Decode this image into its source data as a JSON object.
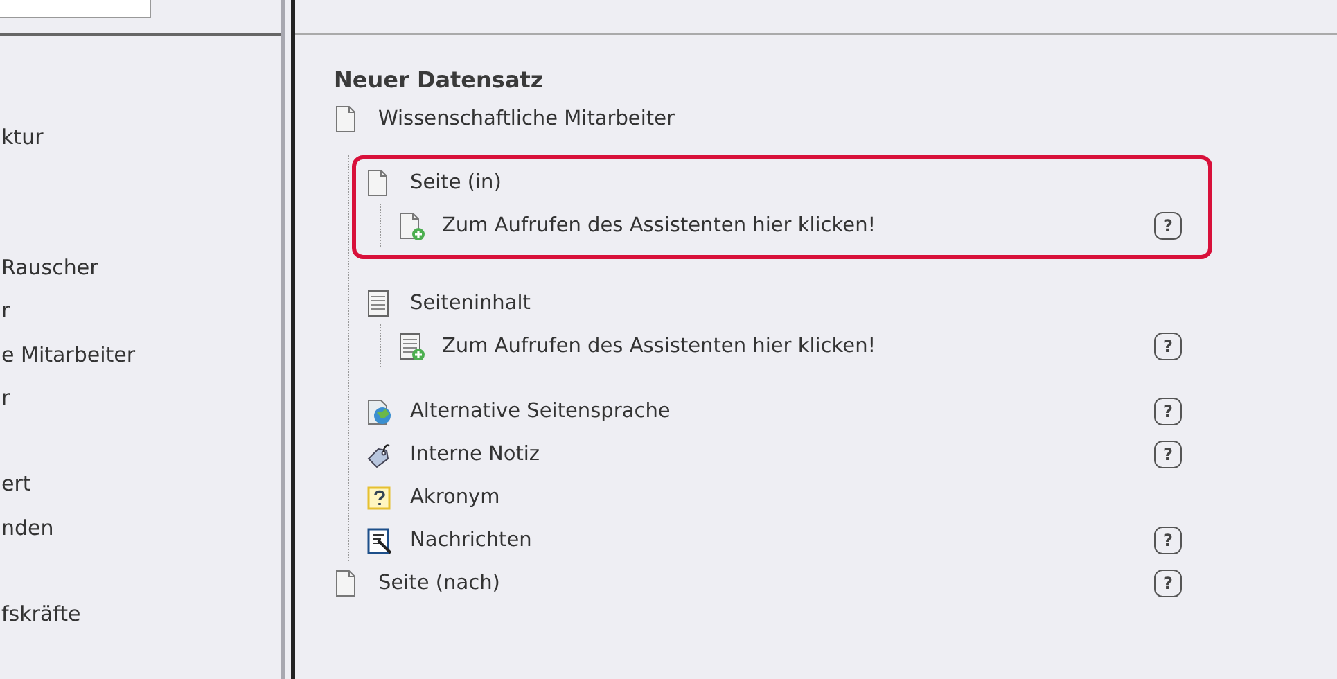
{
  "sidebar": {
    "items": [
      {
        "label": "ktur"
      },
      {
        "label": "Rauscher"
      },
      {
        "label": "r"
      },
      {
        "label": "e Mitarbeiter"
      },
      {
        "label": "r"
      },
      {
        "label": "ert"
      },
      {
        "label": "nden"
      },
      {
        "label": "fskräfte"
      }
    ]
  },
  "panel": {
    "title": "Neuer Datensatz",
    "tree": [
      {
        "kind": "page",
        "label": "Wissenschaftliche Mitarbeiter",
        "children": [
          {
            "kind": "page",
            "label": "Seite (in)",
            "highlighted": true,
            "children": [
              {
                "kind": "page-add",
                "label": "Zum Aufrufen des Assistenten hier klicken!",
                "help": "?"
              }
            ]
          },
          {
            "kind": "content",
            "label": "Seiteninhalt",
            "highlighted": false,
            "children": [
              {
                "kind": "content-add",
                "label": "Zum Aufrufen des Assistenten hier klicken!",
                "help": "?"
              }
            ]
          },
          {
            "kind": "globe",
            "label": "Alternative Seitensprache",
            "help": "?"
          },
          {
            "kind": "tag",
            "label": "Interne Notiz",
            "help": "?"
          },
          {
            "kind": "acronym",
            "label": "Akronym"
          },
          {
            "kind": "notepad",
            "label": "Nachrichten",
            "help": "?"
          }
        ]
      },
      {
        "kind": "page",
        "label": "Seite (nach)",
        "help": "?"
      }
    ]
  }
}
